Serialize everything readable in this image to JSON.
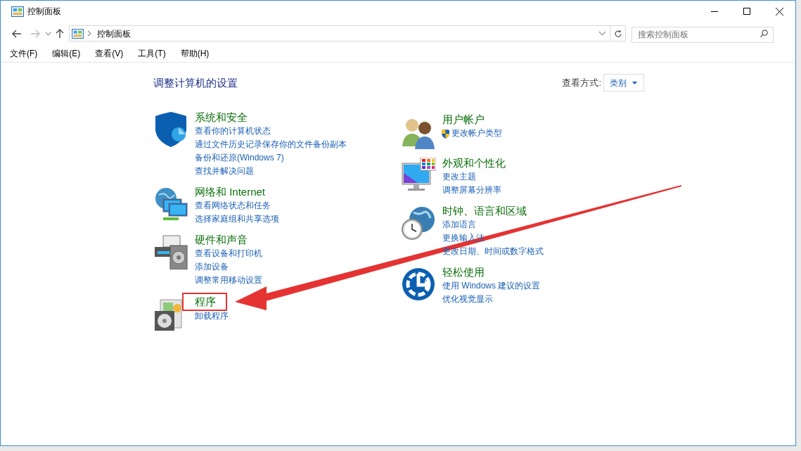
{
  "window": {
    "title": "控制面板"
  },
  "address_bar": {
    "path": "控制面板"
  },
  "search": {
    "placeholder": "搜索控制面板"
  },
  "menu": [
    "文件(F)",
    "编辑(E)",
    "查看(V)",
    "工具(T)",
    "帮助(H)"
  ],
  "heading": "调整计算机的设置",
  "view_by": {
    "label": "查看方式:",
    "value": "类别"
  },
  "columns": [
    [
      {
        "kind": "security",
        "title": "系统和安全",
        "highlighted": false,
        "links": [
          "查看你的计算机状态",
          "通过文件历史记录保存你的文件备份副本",
          "备份和还原(Windows 7)",
          "查找并解决问题"
        ]
      },
      {
        "kind": "network",
        "title": "网络和 Internet",
        "highlighted": false,
        "links": [
          "查看网络状态和任务",
          "选择家庭组和共享选项"
        ]
      },
      {
        "kind": "hardware",
        "title": "硬件和声音",
        "highlighted": false,
        "links": [
          "查看设备和打印机",
          "添加设备",
          "调整常用移动设置"
        ]
      },
      {
        "kind": "programs",
        "title": "程序",
        "highlighted": true,
        "links": [
          "卸载程序"
        ]
      }
    ],
    [
      {
        "kind": "users",
        "title": "用户帐户",
        "highlighted": false,
        "links": [
          "更改帐户类型"
        ],
        "shield": true
      },
      {
        "kind": "appearance",
        "title": "外观和个性化",
        "highlighted": false,
        "links": [
          "更改主题",
          "调整屏幕分辨率"
        ]
      },
      {
        "kind": "clock",
        "title": "时钟、语言和区域",
        "highlighted": false,
        "links": [
          "添加语言",
          "更换输入法",
          "更改日期、时间或数字格式"
        ]
      },
      {
        "kind": "ease",
        "title": "轻松使用",
        "highlighted": false,
        "links": [
          "使用 Windows 建议的设置",
          "优化视觉显示"
        ]
      }
    ]
  ]
}
